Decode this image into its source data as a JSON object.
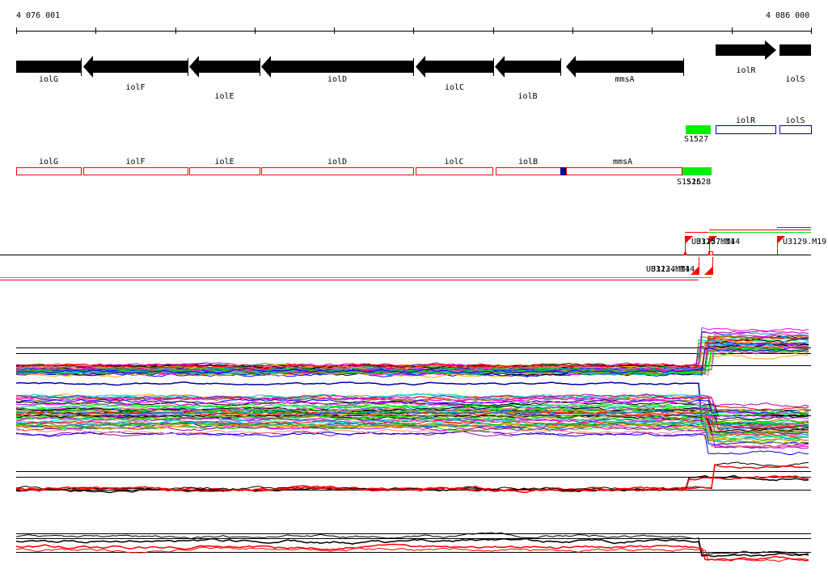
{
  "axis": {
    "start_label": "4 076 001",
    "end_label": "4 086 000"
  },
  "genes": [
    {
      "name": "iolG",
      "strand": "-",
      "arrow": false
    },
    {
      "name": "iolF",
      "strand": "-"
    },
    {
      "name": "iolE",
      "strand": "-"
    },
    {
      "name": "iolD",
      "strand": "-"
    },
    {
      "name": "iolC",
      "strand": "-"
    },
    {
      "name": "iolB",
      "strand": "-"
    },
    {
      "name": "mmsA",
      "strand": "-"
    },
    {
      "name": "iolR",
      "strand": "+"
    },
    {
      "name": "iolS",
      "strand": "+"
    }
  ],
  "forward_features": {
    "green": "S1527",
    "boxes": [
      "iolR",
      "iolS"
    ]
  },
  "reverse_features": {
    "boxes": [
      "iolG",
      "iolF",
      "iolE",
      "iolD",
      "iolC",
      "iolB",
      "mmsA"
    ],
    "green_labels": [
      "S1526",
      "S1528"
    ]
  },
  "tss_forward": [
    "U3125.M14",
    "U3127.M14",
    "U3129.M19"
  ],
  "tss_reverse": [
    "U3123.M14",
    "U3124.M14"
  ],
  "colors": {
    "gene": "#000000",
    "reverse_box": "#ff0000",
    "forward_box": "#0000cc",
    "segment": "#00ee00",
    "marker": "#000080",
    "tss": "#ff0000"
  }
}
